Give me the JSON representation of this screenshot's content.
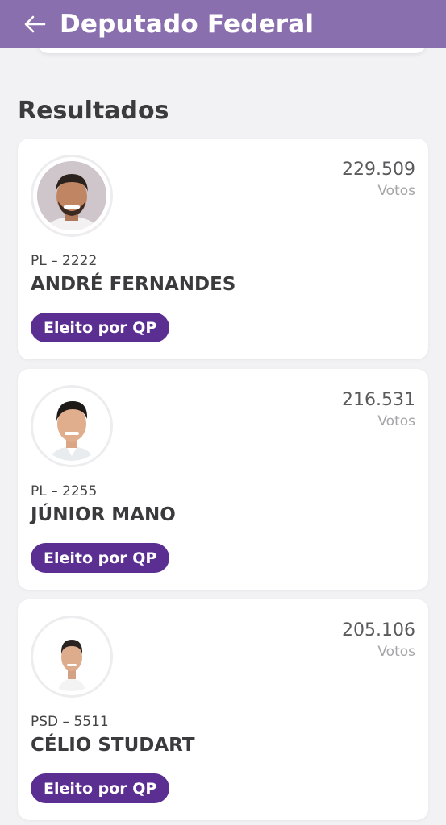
{
  "header": {
    "back_icon": "arrow-left-icon",
    "title": "Deputado Federal",
    "background_color": "#8a6fae"
  },
  "section": {
    "title": "Resultados"
  },
  "candidates": [
    {
      "votes": "229.509",
      "votes_label": "Votos",
      "party": "PL – 2222",
      "name": "ANDRÉ FERNANDES",
      "status": "Eleito por QP",
      "status_color": "#5b2e91"
    },
    {
      "votes": "216.531",
      "votes_label": "Votos",
      "party": "PL – 2255",
      "name": "JÚNIOR MANO",
      "status": "Eleito por QP",
      "status_color": "#5b2e91"
    },
    {
      "votes": "205.106",
      "votes_label": "Votos",
      "party": "PSD – 5511",
      "name": "CÉLIO STUDART",
      "status": "Eleito por QP",
      "status_color": "#5b2e91"
    }
  ]
}
